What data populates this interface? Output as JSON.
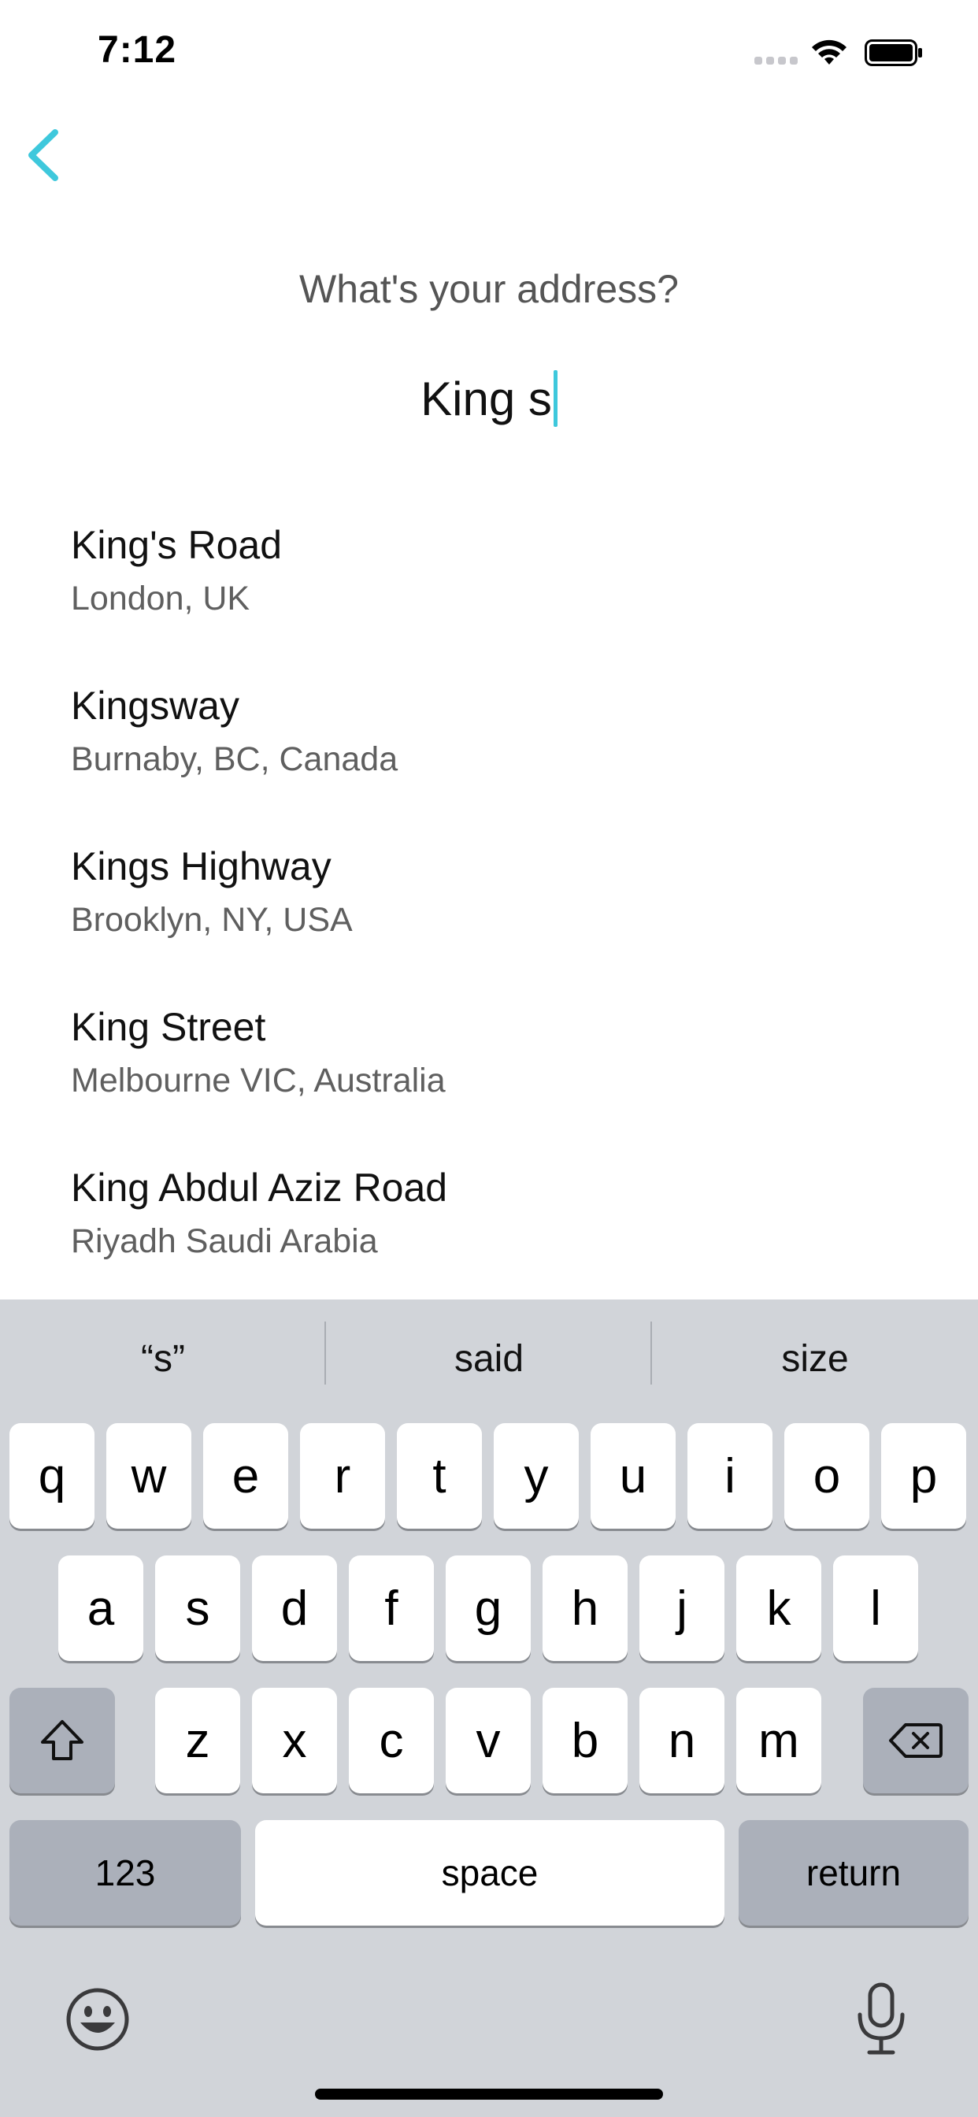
{
  "status_bar": {
    "time": "7:12"
  },
  "screen": {
    "prompt": "What's your address?",
    "address_input": {
      "value": "King s"
    }
  },
  "results": [
    {
      "title": "King's Road",
      "subtitle": "London, UK"
    },
    {
      "title": "Kingsway",
      "subtitle": "Burnaby, BC, Canada"
    },
    {
      "title": "Kings Highway",
      "subtitle": "Brooklyn, NY, USA"
    },
    {
      "title": "King Street",
      "subtitle": "Melbourne VIC, Australia"
    },
    {
      "title": "King Abdul Aziz Road",
      "subtitle": "Riyadh Saudi Arabia"
    }
  ],
  "keyboard": {
    "suggestions": [
      "“s”",
      "said",
      "size"
    ],
    "row1": [
      "q",
      "w",
      "e",
      "r",
      "t",
      "y",
      "u",
      "i",
      "o",
      "p"
    ],
    "row2": [
      "a",
      "s",
      "d",
      "f",
      "g",
      "h",
      "j",
      "k",
      "l"
    ],
    "row3": [
      "z",
      "x",
      "c",
      "v",
      "b",
      "n",
      "m"
    ],
    "numbers_label": "123",
    "space_label": "space",
    "return_label": "return"
  },
  "colors": {
    "accent": "#3ec8dc",
    "keyboard_bg": "#d1d4d9",
    "special_key": "#abb0ba"
  },
  "icons": [
    "back-chevron-icon",
    "wifi-icon",
    "battery-icon",
    "signal-icon",
    "shift-icon",
    "delete-icon",
    "emoji-icon",
    "microphone-icon"
  ]
}
